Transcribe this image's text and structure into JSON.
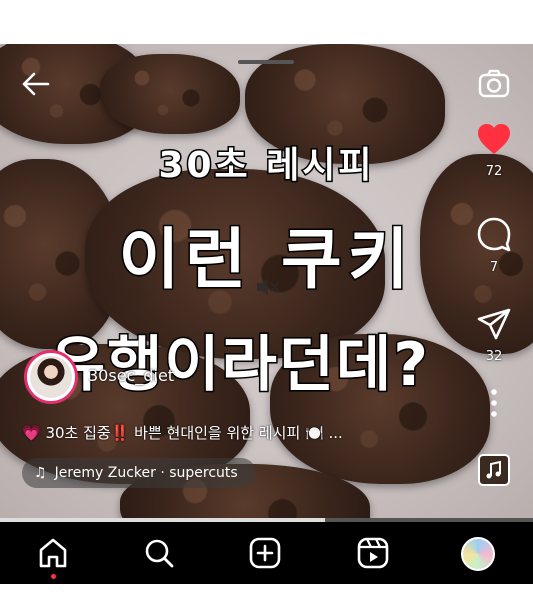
{
  "video": {
    "caption_line1": "30초 레시피",
    "caption_line2": "이런 쿠키",
    "caption_line3": "유행이라던데?",
    "playback_progress": 0.61
  },
  "actions": {
    "like_count": "72",
    "comment_count": "7",
    "share_count": "32"
  },
  "user": {
    "username": "30sec_diet"
  },
  "post": {
    "description": "💗 30초 집중‼️ 바쁜 현대인을 위한 레시피 🍽️ ...",
    "music": "Jeremy Zucker · supercuts"
  },
  "colors": {
    "like_red": "#ff3040",
    "accent_pink": "#e1306c",
    "nav_background": "#000000"
  },
  "icons": [
    "back-arrow-icon",
    "camera-icon",
    "mute-icon",
    "heart-icon",
    "comment-icon",
    "share-icon",
    "more-icon",
    "music-note-icon",
    "home-icon",
    "search-icon",
    "create-icon",
    "reels-icon"
  ]
}
